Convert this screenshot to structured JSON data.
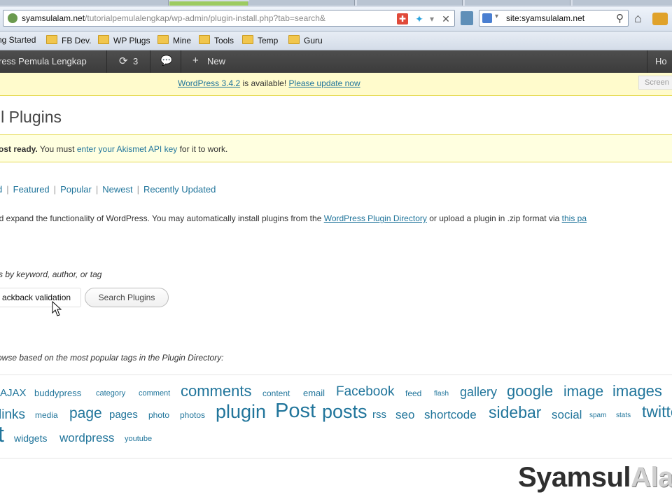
{
  "browser": {
    "url_domain": "syamsulalam.net",
    "url_path": "/tutorialpemulalengkap/wp-admin/plugin-install.php?tab=search&",
    "search_value": "site:syamsulalam.net",
    "bookmarks": [
      "ng Started",
      "FB Dev.",
      "WP Plugs",
      "Mine",
      "Tools",
      "Temp",
      "Guru"
    ]
  },
  "adminbar": {
    "site_name": "ress Pemula Lengkap",
    "updates_count": "3",
    "new_label": "New",
    "howdy": "Ho"
  },
  "nag": {
    "link1": "WordPress 3.4.2",
    "middle": " is available! ",
    "link2": "Please update now",
    "screen_options": "Screen"
  },
  "page": {
    "title": "ll Plugins"
  },
  "akismet": {
    "bold": "ost ready.",
    "pre": " You must ",
    "link": "enter your Akismet API key",
    "post": " for it to work."
  },
  "filters": {
    "items": [
      "d",
      "Featured",
      "Popular",
      "Newest",
      "Recently Updated"
    ]
  },
  "intro": {
    "pre": "nd expand the functionality of WordPress. You may automatically install plugins from the ",
    "link1": "WordPress Plugin Directory",
    "mid": " or upload a plugin in .zip format via ",
    "link2": "this pa"
  },
  "search": {
    "hint": "s by keyword, author, or tag",
    "term_value": "ackback validation",
    "button_label": "Search Plugins"
  },
  "tags": {
    "hint": "owse based on the most popular tags in the Plugin Directory:",
    "items": [
      "AJAX",
      "buddypress",
      "category",
      "comment",
      "comments",
      "content",
      "email",
      "Facebook",
      "feed",
      "flash",
      "gallery",
      "google",
      "image",
      "images",
      "links",
      "media",
      "page",
      "pages",
      "photo",
      "photos",
      "plugin",
      "Post",
      "posts",
      "rss",
      "seo",
      "shortcode",
      "sidebar",
      "social",
      "spam",
      "stats",
      "twitte",
      "t",
      "widgets",
      "wordpress",
      "youtube"
    ]
  },
  "watermark": {
    "part1": "Syamsul",
    "part2": "Ala"
  }
}
